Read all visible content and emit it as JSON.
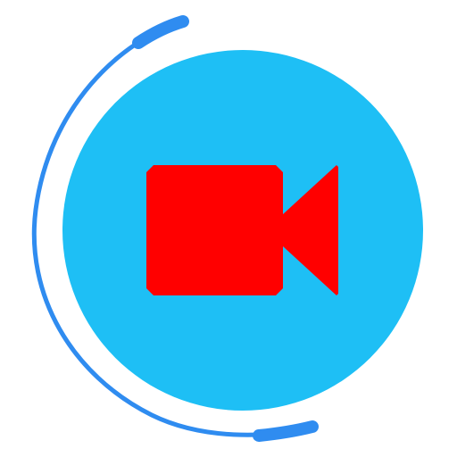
{
  "app_icon": {
    "name": "video-camera-app-icon",
    "icon": "video-camera-icon",
    "colors": {
      "background": "#ffffff",
      "circle": "#1ebff5",
      "arc": "#2f8cf0",
      "camera": "#ff0000"
    }
  }
}
